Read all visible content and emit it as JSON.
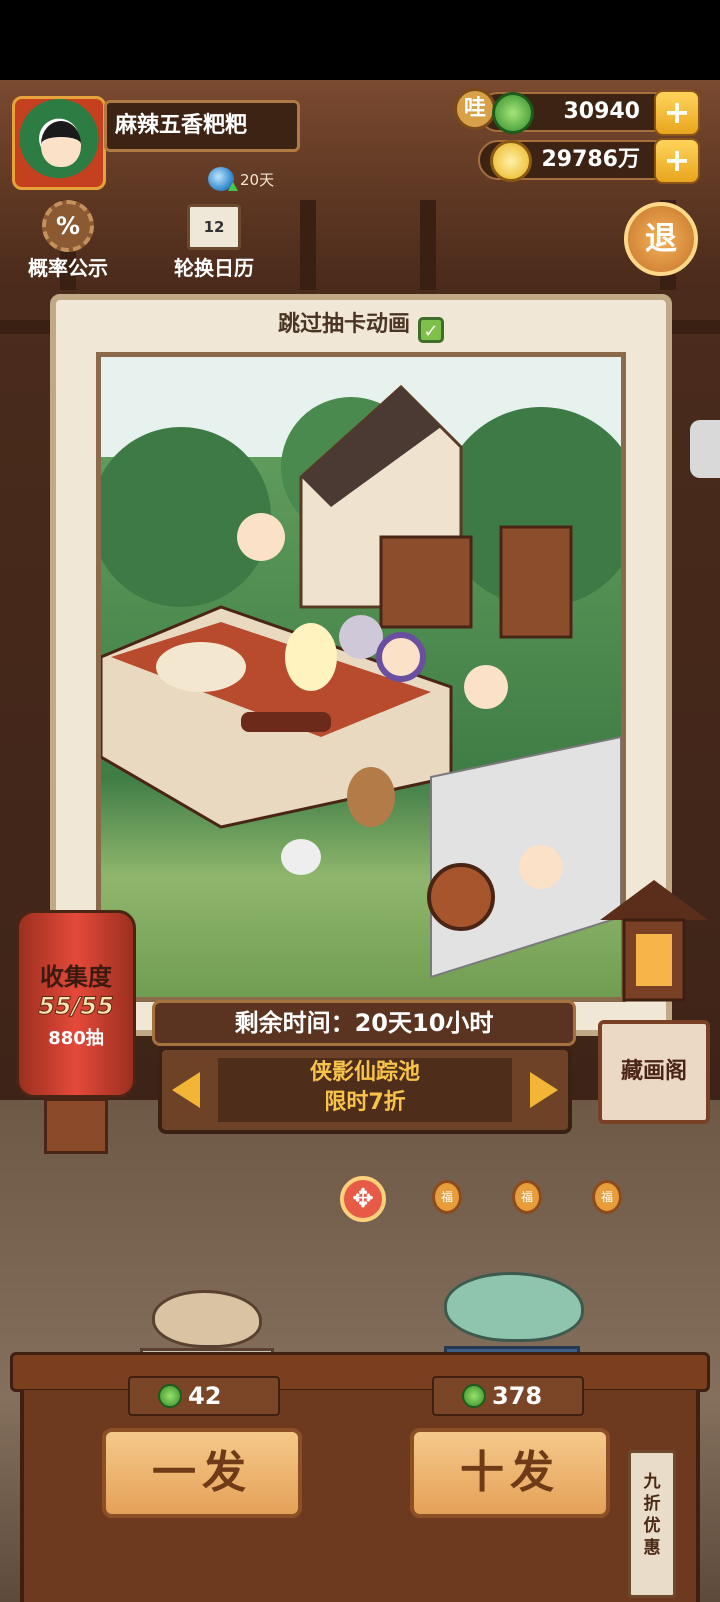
{
  "player": {
    "name": "麻辣五香粑粑",
    "days": "20天"
  },
  "resources": {
    "jade": "30940",
    "gold": "29786万",
    "jade_label": "哇"
  },
  "top_buttons": {
    "probability": "概率公示",
    "probability_symbol": "%",
    "calendar": "轮换日历",
    "calendar_number": "12",
    "exit": "退"
  },
  "panel": {
    "skip_animation": "跳过抽卡动画",
    "skip_checked": true
  },
  "timer": {
    "remaining": "剩余时间：20天10小时"
  },
  "pool": {
    "name": "侠影仙踪池",
    "discount": "限时7折"
  },
  "collection": {
    "label": "收集度",
    "progress": "55/55",
    "draws": "880抽"
  },
  "gallery": {
    "label": "藏画阁"
  },
  "pager": {
    "active_symbol": "✥",
    "dots": [
      "福",
      "福",
      "福"
    ]
  },
  "draw": {
    "single": {
      "label": "一发",
      "cost": "42"
    },
    "ten": {
      "label": "十发",
      "cost": "378"
    },
    "tag": [
      "九",
      "折",
      "优",
      "惠"
    ]
  },
  "colors": {
    "gold": "#f7c34a",
    "wood": "#6d3a1f",
    "lantern": "#e5493a",
    "jade": "#2f8c2a"
  }
}
